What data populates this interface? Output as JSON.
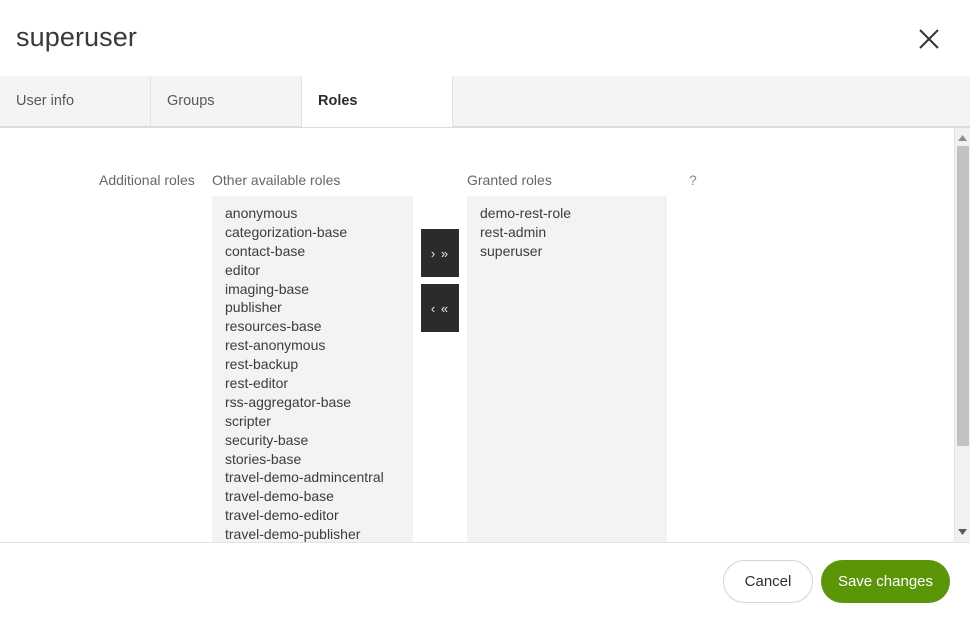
{
  "header": {
    "title": "superuser",
    "close_icon": "close-icon"
  },
  "tabs": [
    {
      "label": "User info",
      "active": false
    },
    {
      "label": "Groups",
      "active": false
    },
    {
      "label": "Roles",
      "active": true
    }
  ],
  "content": {
    "additional_roles_label": "Additional roles",
    "other_available_label": "Other available roles",
    "granted_label": "Granted roles",
    "help_icon_label": "?",
    "other_available_roles": [
      "anonymous",
      "categorization-base",
      "contact-base",
      "editor",
      "imaging-base",
      "publisher",
      "resources-base",
      "rest-anonymous",
      "rest-backup",
      "rest-editor",
      "rss-aggregator-base",
      "scripter",
      "security-base",
      "stories-base",
      "travel-demo-admincentral",
      "travel-demo-base",
      "travel-demo-editor",
      "travel-demo-publisher"
    ],
    "granted_roles": [
      "demo-rest-role",
      "rest-admin",
      "superuser"
    ],
    "add_button_label": "› »",
    "remove_button_label": "‹ «"
  },
  "footer": {
    "cancel_label": "Cancel",
    "save_label": "Save changes"
  },
  "colors": {
    "accent_green": "#5a9608",
    "transfer_button": "#2b2b2b",
    "listbox_background": "#f3f3f3",
    "tab_inactive_background": "#f4f4f4"
  }
}
